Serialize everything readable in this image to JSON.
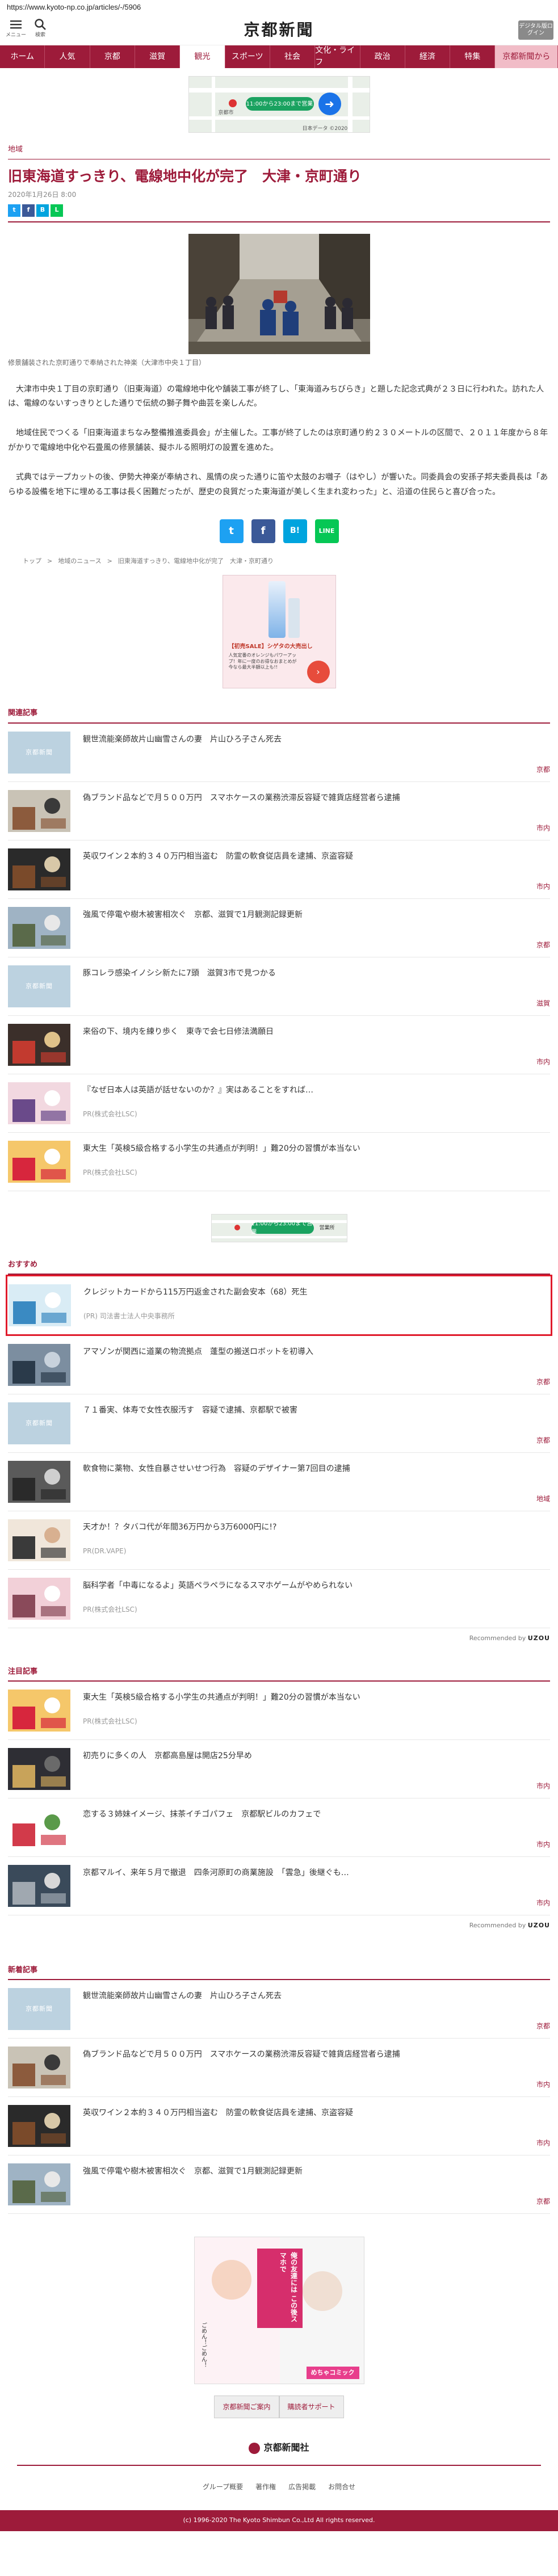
{
  "url": "https://www.kyoto-np.co.jp/articles/-/5906",
  "header": {
    "logo": "京都新聞",
    "menu_label": "メニュー",
    "search_label": "検索",
    "digital_label": "デジタル版ログイン"
  },
  "nav": [
    "ホーム",
    "人気",
    "京都",
    "滋賀",
    "観光",
    "スポーツ",
    "社会",
    "文化・ライフ",
    "政治",
    "経済",
    "特集",
    "京都新聞から"
  ],
  "nav_active": 4,
  "ad_map": {
    "button": "11:00から23:00まで営業",
    "label_a": "京都市",
    "label_b": "日本データ ©2020"
  },
  "article": {
    "category": "地域",
    "title": "旧東海道すっきり、電線地中化が完了　大津・京町通り",
    "date": "2020年1月26日 8:00",
    "caption": "修景舗装された京町通りで奉納された神楽（大津市中央１丁目）",
    "paragraphs": [
      "大津市中央１丁目の京町通り（旧東海道）の電線地中化や舗装工事が終了し、「東海道みちびらき」と題した記念式典が２３日に行われた。訪れた人は、電線のないすっきりとした通りで伝統の獅子舞や曲芸を楽しんだ。",
      "地域住民でつくる「旧東海道まちなみ整備推進委員会」が主催した。工事が終了したのは京町通り約２３０メートルの区間で、２０１１年度から８年がかりで電線地中化や石畳風の修景舗装、擬ホルる照明灯の設置を進めた。",
      "式典ではテープカットの後、伊勢大神楽が奉納され、風情の戻った通りに笛や太鼓のお囃子（はやし）が響いた。同委員会の安孫子邦夫委員長は「あらゆる設備を地下に埋める工事は長く困難だったが、歴史の良質だった東海道が美しく生まれ変わった」と、沿道の住民らと喜び合った。"
    ],
    "share_small": [
      "t",
      "f",
      "B",
      "L"
    ],
    "share_large": [
      "t",
      "f",
      "B!",
      "LINE"
    ]
  },
  "breadcrumb": [
    "トップ",
    "地域のニュース",
    "旧東海道すっきり、電線地中化が完了　大津・京町通り"
  ],
  "ad_square": {
    "badge": "【初売SALE】シゲタの大売出し",
    "text": "人気定番のオレンジもパワーアップ！年に一度のお得なおまとめが今なら最大半額以上も!!",
    "cta": ""
  },
  "related": {
    "heading": "関連記事",
    "items": [
      {
        "title": "観世流能楽師故片山幽雪さんの妻　片山ひろ子さん死去",
        "tag": "京都",
        "thumb": "placeholder"
      },
      {
        "title": "偽ブランド品などで月５００万円　スマホケースの業務渋滞反容疑で雑貨店経営者ら逮捕",
        "tag": "市内",
        "thumb": "photo1"
      },
      {
        "title": "英収ワイン２本約３４０万円相当盗む　防霊の軟食従店員を逮捕、京盗容疑",
        "tag": "市内",
        "thumb": "photo2"
      },
      {
        "title": "強風で停電や樹木被害相次ぐ　京都、滋賀で1月観測記録更新",
        "tag": "京都",
        "thumb": "photo3"
      },
      {
        "title": "豚コレラ感染イノシシ新たに7頭　滋賀3市で見つかる",
        "tag": "滋賀",
        "thumb": "placeholder"
      },
      {
        "title": "来俗の下、境内を練り歩く　東寺で会七日修法満願日",
        "tag": "市内",
        "thumb": "photo4"
      },
      {
        "title": "『なぜ日本人は英語が話せないのか？』実はあることをすれば…",
        "pr": "PR(株式会社LSC)",
        "thumb": "pr1"
      },
      {
        "title": "東大生「英検5級合格する小学生の共通点が判明！」難20分の習慣が本当ない",
        "pr": "PR(株式会社LSC)",
        "thumb": "pr2"
      }
    ]
  },
  "ad_map_sm": {
    "button": "11:00から23:00まで営業",
    "label": "営業所"
  },
  "recommend": {
    "heading": "おすすめ",
    "items": [
      {
        "title": "クレジットカードから115万円返金された副会安本（68）死生",
        "pr": "(PR) 司法書士法人中央事務所",
        "thumb": "rec1",
        "highlight": true
      },
      {
        "title": "アマゾンが関西に道業の物流拠点　蓬型の搬送ロボットを初導入",
        "tag": "京都",
        "thumb": "rec2"
      },
      {
        "title": "７１番実、体寿で女性衣服汚す　容疑で逮捕、京都駅で被害",
        "tag": "京都",
        "thumb": "placeholder"
      },
      {
        "title": "軟食物に薬物、女性自暴させいせつ行為　容疑のデザイナー第7回目の逮捕",
        "tag": "地域",
        "thumb": "rec3"
      },
      {
        "title": "天才か！？タバコ代が年間36万円から3万6000円に!?",
        "pr": "PR(DR.VAPE)",
        "thumb": "rec4"
      },
      {
        "title": "脳科学者「中毒になるよ」英語ペラペラになるスマホゲームがやめられない",
        "pr": "PR(株式会社LSC)",
        "thumb": "rec5"
      }
    ],
    "powered": "Recommended by",
    "brand": "UZOU"
  },
  "attention": {
    "heading": "注目記事",
    "items": [
      {
        "title": "東大生「英検5級合格する小学生の共通点が判明！」難20分の習慣が本当ない",
        "pr": "PR(株式会社LSC)",
        "thumb": "pr2"
      },
      {
        "title": "初売りに多くの人　京都高島屋は開店25分早め",
        "tag": "市内",
        "thumb": "att1"
      },
      {
        "title": "恋する３姉妹イメージ、抹茶イチゴパフェ　京都駅ビルのカフェで",
        "tag": "市内",
        "thumb": "att2"
      },
      {
        "title": "京都マルイ、来年５月で撤退　四条河原町の商業施設　「雲急」後継ぐも…",
        "tag": "市内",
        "thumb": "att3"
      }
    ],
    "powered": "Recommended by",
    "brand": "UZOU"
  },
  "latest": {
    "heading": "新着記事",
    "items": [
      {
        "title": "観世流能楽師故片山幽雪さんの妻　片山ひろ子さん死去",
        "tag": "京都",
        "thumb": "placeholder"
      },
      {
        "title": "偽ブランド品などで月５００万円　スマホケースの業務渋滞反容疑で雑貨店経営者ら逮捕",
        "tag": "市内",
        "thumb": "photo1"
      },
      {
        "title": "英収ワイン２本約３４０万円相当盗む　防霊の軟食従店員を逮捕、京盗容疑",
        "tag": "市内",
        "thumb": "photo2"
      },
      {
        "title": "強風で停電や樹木被害相次ぐ　京都、滋賀で1月観測記録更新",
        "tag": "京都",
        "thumb": "photo3"
      }
    ]
  },
  "comic": {
    "text_a": "俺の友達には",
    "text_b": "この後スマホで",
    "text_c": "ごめん！ごめん！",
    "brand": "めちゃコミック"
  },
  "bottom_buttons": [
    "京都新聞ご案内",
    "購読者サポート"
  ],
  "footer": {
    "logo": "京都新聞社",
    "links": [
      "グループ概要",
      "著作権",
      "広告掲載",
      "お問合せ"
    ],
    "copyright": "(c) 1996-2020 The Kyoto Shimbun Co.,Ltd All rights reserved."
  },
  "colors": {
    "brand": "#9d1b3a",
    "highlight": "#e01a2b"
  }
}
